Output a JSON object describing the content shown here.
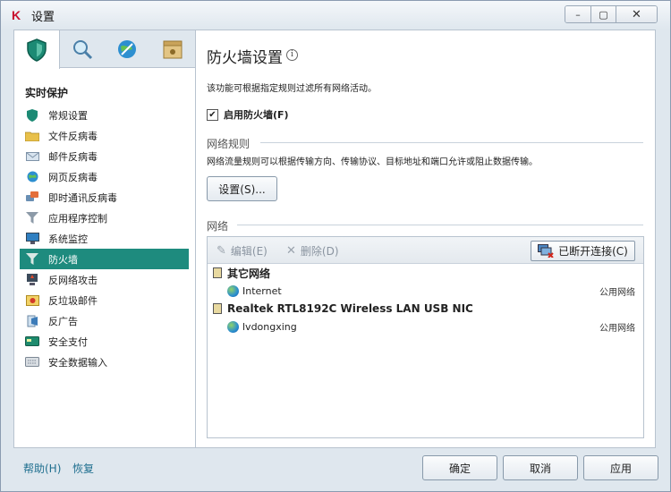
{
  "window": {
    "title": "设置",
    "minimize": "–",
    "maximize": "▢",
    "close": "✕"
  },
  "sidebar": {
    "tabs": [
      "protection",
      "scan",
      "update",
      "settings"
    ],
    "section_title": "实时保护",
    "items": [
      {
        "label": "常规设置",
        "icon": "shield-icon"
      },
      {
        "label": "文件反病毒",
        "icon": "folder-icon"
      },
      {
        "label": "邮件反病毒",
        "icon": "mail-icon"
      },
      {
        "label": "网页反病毒",
        "icon": "globe-icon"
      },
      {
        "label": "即时通讯反病毒",
        "icon": "chat-icon"
      },
      {
        "label": "应用程序控制",
        "icon": "filter-icon"
      },
      {
        "label": "系统监控",
        "icon": "monitor-icon"
      },
      {
        "label": "防火墙",
        "icon": "firewall-icon",
        "active": true
      },
      {
        "label": "反网络攻击",
        "icon": "network-attack-icon"
      },
      {
        "label": "反垃圾邮件",
        "icon": "spam-icon"
      },
      {
        "label": "反广告",
        "icon": "ad-block-icon"
      },
      {
        "label": "安全支付",
        "icon": "payment-icon"
      },
      {
        "label": "安全数据输入",
        "icon": "keyboard-icon"
      }
    ]
  },
  "main": {
    "title": "防火墙设置",
    "description": "该功能可根据指定规则过滤所有网络活动。",
    "enable_firewall": {
      "label": "启用防火墙(F)",
      "checked": true
    },
    "rules": {
      "heading": "网络规则",
      "description": "网络流量规则可以根据传输方向、传输协议、目标地址和端口允许或阻止数据传输。",
      "settings_button": "设置(S)..."
    },
    "network": {
      "heading": "网络",
      "edit": "编辑(E)",
      "delete": "删除(D)",
      "disconnect": "已断开连接(C)",
      "groups": [
        {
          "name": "其它网络",
          "rows": [
            {
              "name": "Internet",
              "type": "公用网络"
            }
          ]
        },
        {
          "name": "Realtek RTL8192C Wireless LAN USB NIC",
          "rows": [
            {
              "name": "lvdongxing",
              "type": "公用网络"
            }
          ]
        }
      ]
    }
  },
  "footer": {
    "help": "帮助(H)",
    "restore": "恢复",
    "ok": "确定",
    "cancel": "取消",
    "apply": "应用"
  },
  "colors": {
    "active_nav": "#1e8b7e",
    "brand_red": "#c8102e"
  }
}
